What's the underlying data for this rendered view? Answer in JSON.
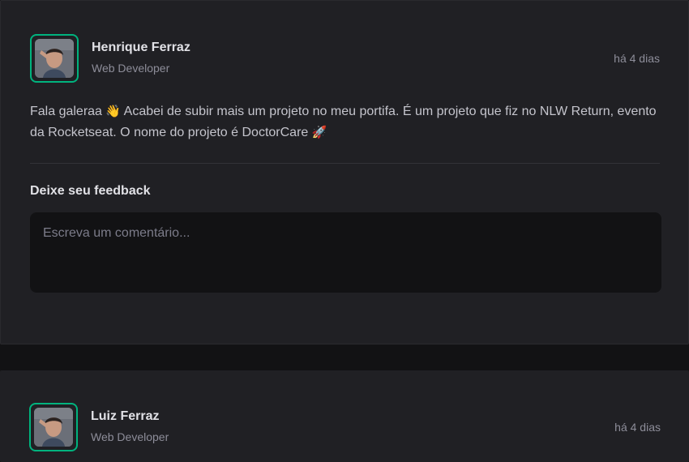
{
  "posts": [
    {
      "author": {
        "name": "Henrique Ferraz",
        "role": "Web Developer"
      },
      "time": "há 4 dias",
      "content": {
        "line1": "Fala galeraa",
        "emoji1": "👋",
        "line2": "Acabei de subir mais um projeto no meu portifa. É um projeto que fiz no NLW Return, evento da Rocketseat. O nome do projeto é DoctorCare",
        "emoji2": "🚀"
      },
      "feedback": {
        "title": "Deixe seu feedback",
        "placeholder": "Escreva um comentário..."
      }
    },
    {
      "author": {
        "name": "Luiz Ferraz",
        "role": "Web Developer"
      },
      "time": "há 4 dias"
    }
  ],
  "colors": {
    "accent": "#00b37e",
    "card": "#202024",
    "background": "#121214"
  }
}
